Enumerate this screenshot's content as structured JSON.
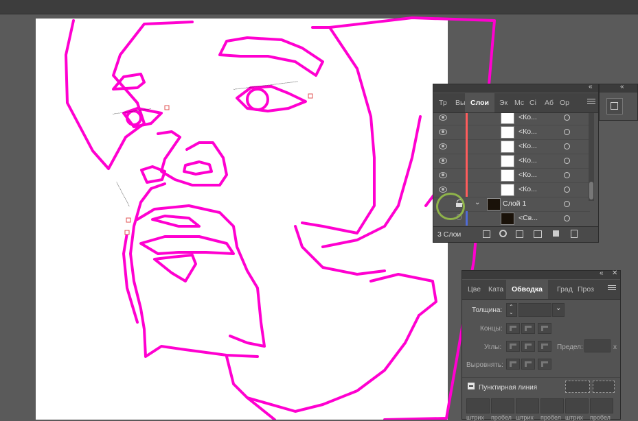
{
  "layers_panel": {
    "tabs": [
      "Тр",
      "Вы",
      "Слои",
      "Эк",
      "Мс",
      "Ci",
      "Аб",
      "Ор"
    ],
    "active_tab": "Слои",
    "rows": [
      {
        "label": "<Ко...",
        "color": "#ff5c5c"
      },
      {
        "label": "<Ко...",
        "color": "#ff5c5c"
      },
      {
        "label": "<Ко...",
        "color": "#ff5c5c"
      },
      {
        "label": "<Ко...",
        "color": "#ff5c5c"
      },
      {
        "label": "<Ко...",
        "color": "#ff5c5c"
      },
      {
        "label": "<Ко...",
        "color": "#ff5c5c"
      }
    ],
    "layer_row": {
      "label": "Слой 1",
      "locked": true
    },
    "sub_row": {
      "label": "<Св..."
    },
    "status": "3 Слои"
  },
  "stroke_panel": {
    "tabs": [
      "Цве",
      "Ката",
      "Обводка",
      "Град",
      "Проз"
    ],
    "active_tab": "Обводка",
    "weight_label": "Толщина:",
    "caps_label": "Концы:",
    "corners_label": "Углы:",
    "limit_label": "Предел:",
    "limit_suffix": "x",
    "align_label": "Выровнять:",
    "dashed_label": "Пунктирная линия",
    "dashed_checked": false,
    "dash_fields": [
      "штрих",
      "пробел",
      "штрих",
      "пробел",
      "штрих",
      "пробел"
    ]
  },
  "colors": {
    "artwork_stroke": "#ff00d0",
    "annotation_circle": "#8fb34a",
    "layer_color_bar": "#ff5c5c",
    "sublayer_color_bar": "#4f6bd6"
  }
}
